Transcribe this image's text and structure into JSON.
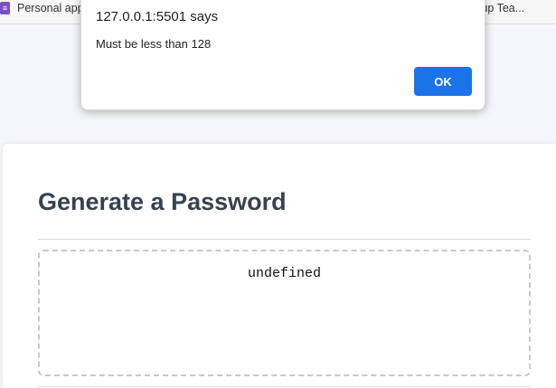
{
  "bookmarks_bar": {
    "items": [
      {
        "label": "Personal app",
        "icon": "app-icon"
      },
      {
        "label": "etup Tea..."
      }
    ]
  },
  "card": {
    "title": "Generate a Password",
    "password_value": "undefined"
  },
  "dialog": {
    "title": "127.0.0.1:5501 says",
    "message": "Must be less than 128",
    "ok_label": "OK"
  },
  "colors": {
    "dialog_button": "#1a73e8",
    "title_text": "#36424f",
    "bookmark_icon": "#7a4fc4"
  }
}
